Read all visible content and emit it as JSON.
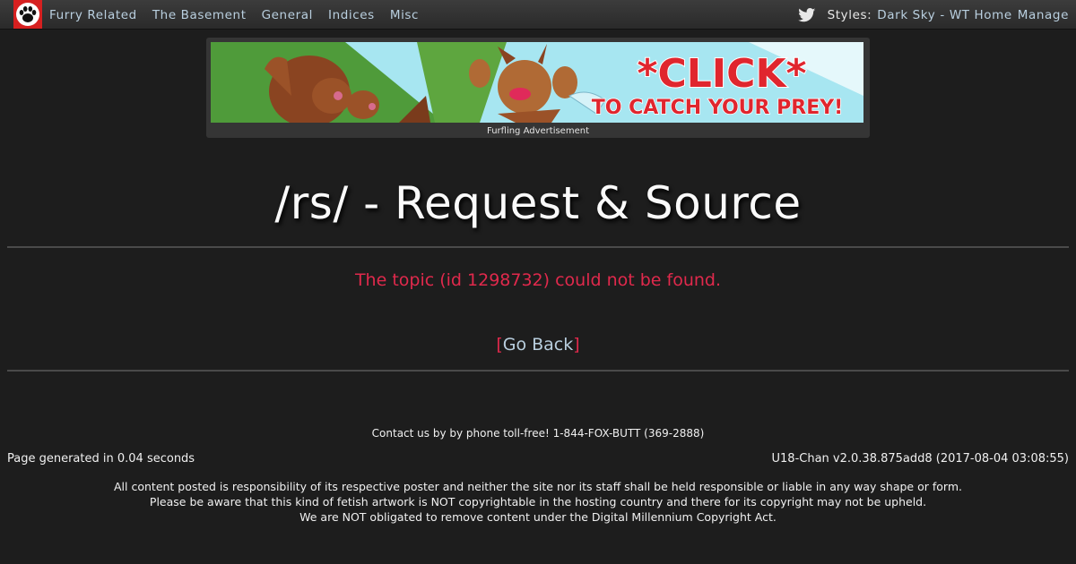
{
  "nav": {
    "links": [
      "Furry Related",
      "The Basement",
      "General",
      "Indices",
      "Misc"
    ],
    "styles_label": "Styles:",
    "style_current": "Dark Sky",
    "separator": "-",
    "wt_home": "WT Home",
    "manage": "Manage"
  },
  "ad": {
    "headline": "*CLICK*",
    "subline": "TO CATCH YOUR PREY!",
    "caption": "Furfling Advertisement"
  },
  "main": {
    "board_title": "/rs/ - Request & Source",
    "error": "The topic (id 1298732) could not be found.",
    "go_back_open": "[",
    "go_back_label": "Go Back",
    "go_back_close": "]"
  },
  "footer": {
    "contact": "Contact us by by phone toll-free! 1-844-FOX-BUTT (369-2888)",
    "generated": "Page generated in 0.04 seconds",
    "version": "U18-Chan v2.0.38.875add8 (2017-08-04 03:08:55)",
    "disclaimer": [
      "All content posted is responsibility of its respective poster and neither the site nor its staff shall be held responsible or liable in any way shape or form.",
      "Please be aware that this kind of fetish artwork is NOT copyrightable in the hosting country and there for its copyright may not be upheld.",
      "We are NOT obligated to remove content under the Digital Millennium Copyright Act."
    ]
  },
  "icons": {
    "logo": "paw-print-icon",
    "social": "twitter-bird-icon"
  },
  "colors": {
    "background": "#1d1d1d",
    "link": "#b9cfdf",
    "error": "#e0294c",
    "logo": "#d62020"
  }
}
